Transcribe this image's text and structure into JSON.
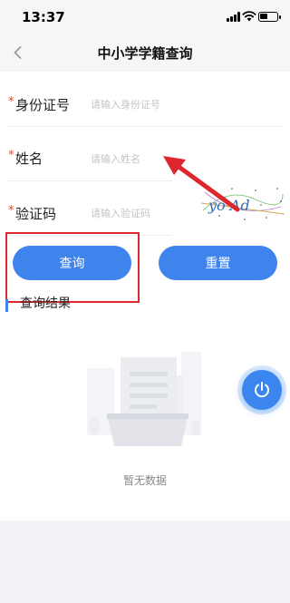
{
  "status_bar": {
    "time": "13:37",
    "battery_level": 0.45
  },
  "nav": {
    "title": "中小学学籍查询"
  },
  "form": {
    "required_mark": "*",
    "fields": [
      {
        "label": "身份证号",
        "placeholder": "请输入身份证号",
        "value": ""
      },
      {
        "label": "姓名",
        "placeholder": "请输入姓名",
        "value": ""
      },
      {
        "label": "验证码",
        "placeholder": "请输入验证码",
        "value": ""
      }
    ],
    "captcha_text": "yo Ad"
  },
  "buttons": {
    "query": "查询",
    "reset": "重置"
  },
  "result": {
    "title": "查询结果",
    "empty_text": "暂无数据"
  },
  "colors": {
    "primary": "#3f84ec",
    "required": "#e24a3b",
    "annotation": "#e0262d"
  },
  "icons": {
    "back": "chevron-left-icon",
    "fab": "power-icon",
    "empty": "empty-document-icon"
  }
}
